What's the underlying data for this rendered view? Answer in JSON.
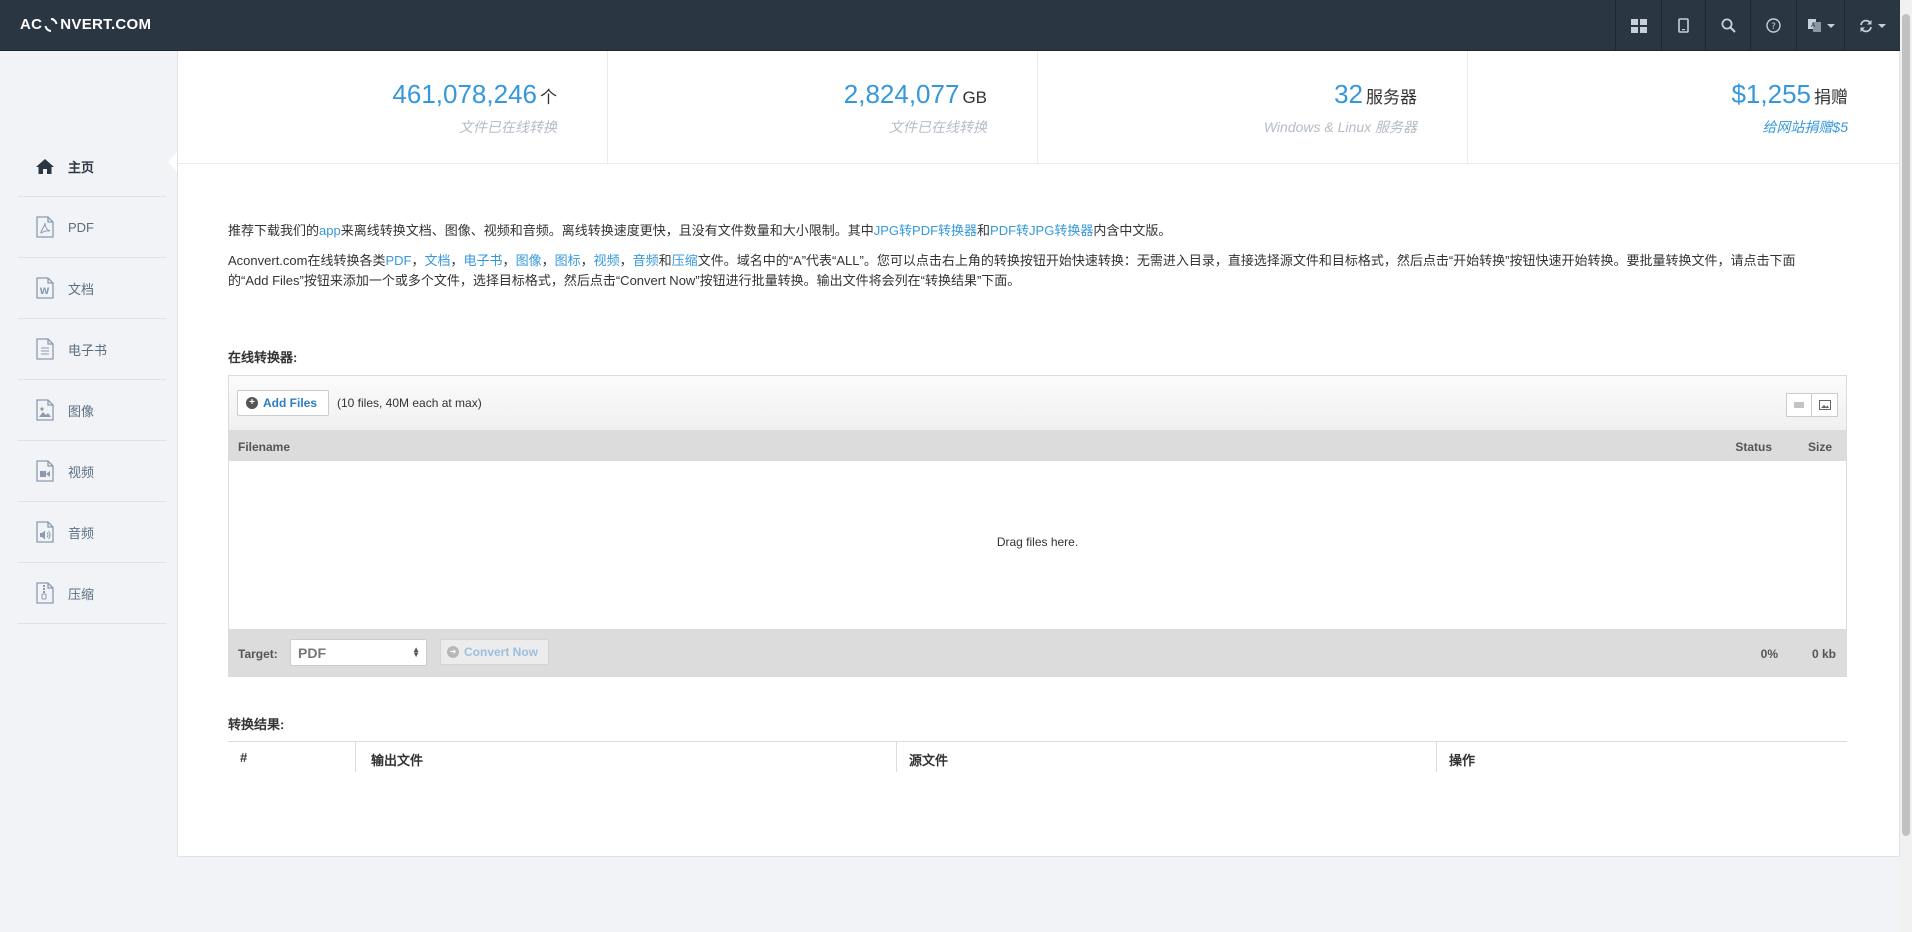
{
  "header": {
    "logo_text_left": "AC",
    "logo_text_right": "NVERT.COM",
    "icons": [
      "grid-icon",
      "tablet-icon",
      "search-icon",
      "help-icon",
      "language-icon",
      "refresh-icon"
    ]
  },
  "sidebar": {
    "items": [
      {
        "label": "主页",
        "icon": "home-icon",
        "active": true
      },
      {
        "label": "PDF",
        "icon": "pdf-file-icon"
      },
      {
        "label": "文档",
        "icon": "word-file-icon"
      },
      {
        "label": "电子书",
        "icon": "ebook-file-icon"
      },
      {
        "label": "图像",
        "icon": "image-file-icon"
      },
      {
        "label": "视频",
        "icon": "video-file-icon"
      },
      {
        "label": "音频",
        "icon": "audio-file-icon"
      },
      {
        "label": "压缩",
        "icon": "archive-file-icon"
      }
    ]
  },
  "stats": [
    {
      "value": "461,078,246",
      "unit": "个",
      "desc": "文件已在线转换"
    },
    {
      "value": "2,824,077",
      "unit": "GB",
      "desc": "文件已在线转换"
    },
    {
      "value": "32",
      "unit": "服务器",
      "desc": "Windows & Linux 服务器"
    },
    {
      "value": "$1,255",
      "unit": "捐赠",
      "desc": "给网站捐赠$5"
    }
  ],
  "intro": {
    "p1": {
      "t1": "推荐下载我们的",
      "link_app": "app",
      "t2": "来离线转换文档、图像、视频和音频。离线转换速度更快，且没有文件数量和大小限制。其中",
      "link_jpg2pdf": "JPG转PDF转换器",
      "t3": "和",
      "link_pdf2jpg": "PDF转JPG转换器",
      "t4": "内含中文版。"
    },
    "p2": {
      "t1": "Aconvert.com在线转换各类",
      "links": [
        "PDF",
        "文档",
        "电子书",
        "图像",
        "图标",
        "视频",
        "音频",
        "压缩"
      ],
      "sep": "，",
      "and": "和",
      "t2": "文件。域名中的“A”代表“ALL”。您可以点击右上角的转换按钮开始快速转换：无需进入目录，直接选择源文件和目标格式，然后点击“开始转换”按钮快速开始转换。要批量转换文件，请点击下面的“Add Files”按钮来添加一个或多个文件，选择目标格式，然后点击“Convert Now”按钮进行批量转换。输出文件将会列在“转换结果”下面。"
    }
  },
  "converter": {
    "title": "在线转换器:",
    "add_files_label": "Add Files",
    "limits_text": "(10 files, 40M each at max)",
    "columns": {
      "filename": "Filename",
      "status": "Status",
      "size": "Size"
    },
    "drag_text": "Drag files here.",
    "target_label": "Target:",
    "target_value": "PDF",
    "convert_label": "Convert Now",
    "progress": "0%",
    "total_size": "0 kb"
  },
  "results": {
    "title": "转换结果:",
    "columns": [
      "#",
      "输出文件",
      "源文件",
      "操作"
    ]
  },
  "colors": {
    "topbar": "#2b3643",
    "accent": "#3598dc",
    "page_bg": "#f1f3f6"
  }
}
